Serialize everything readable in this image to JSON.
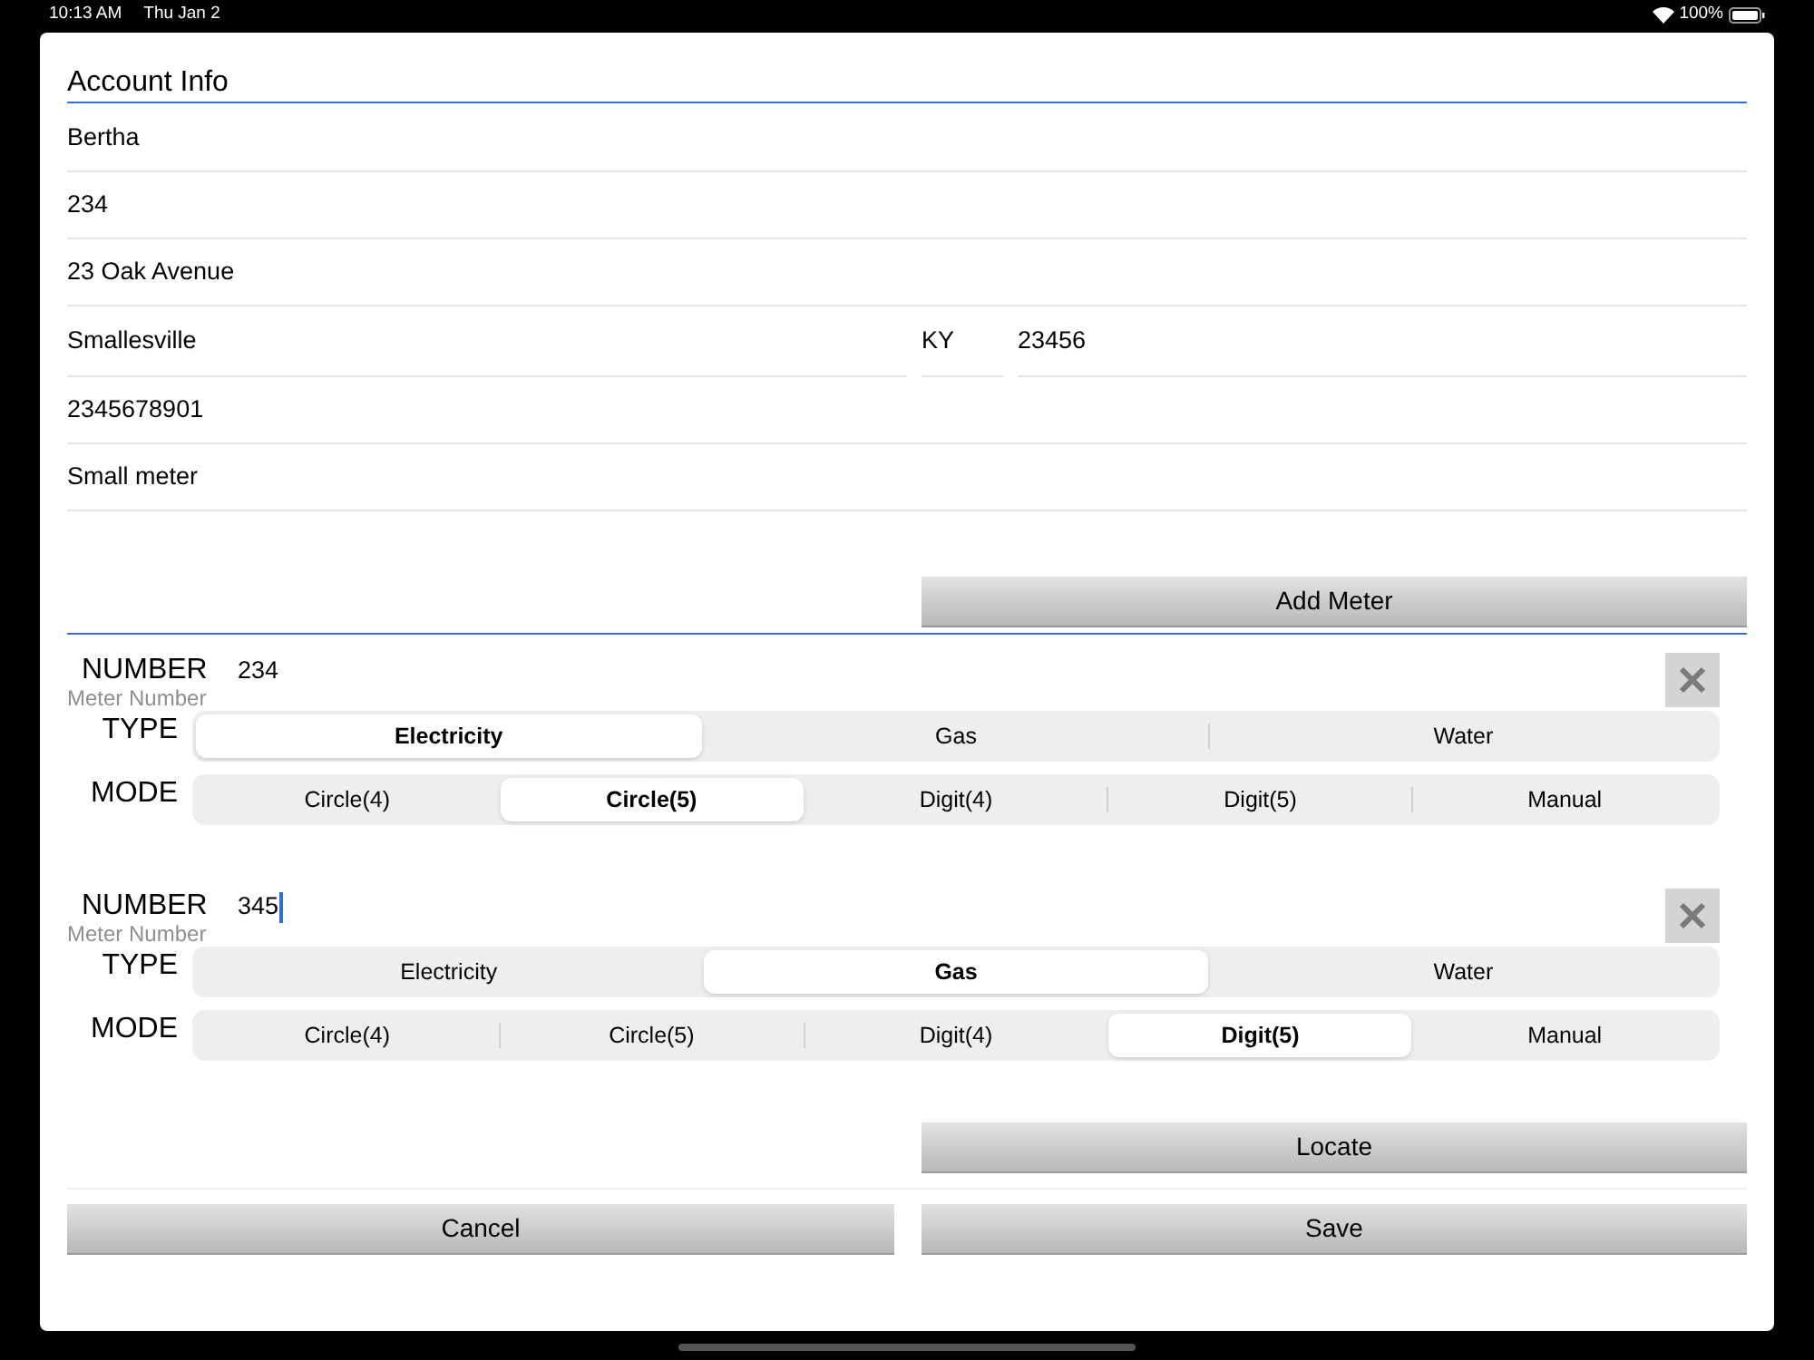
{
  "status_bar": {
    "time": "10:13 AM",
    "date": "Thu Jan 2",
    "battery": "100%"
  },
  "account": {
    "title": "Account Info",
    "fields": [
      {
        "value": "Bertha"
      },
      {
        "value": "234"
      },
      {
        "value": "23 Oak Avenue"
      }
    ],
    "city": {
      "value": "Smallesville"
    },
    "state": {
      "value": "KY"
    },
    "zip": {
      "value": "23456"
    },
    "fields_after": [
      {
        "value": "2345678901"
      },
      {
        "value": "Small meter"
      }
    ],
    "add_button": "Add Meter"
  },
  "meters": [
    {
      "number_label": "NUMBER",
      "number": "234",
      "focused": false,
      "hint": "Meter Number",
      "type_label": "TYPE",
      "types": [
        {
          "label": "Electricity",
          "selected": true
        },
        {
          "label": "Gas",
          "selected": false
        },
        {
          "label": "Water",
          "selected": false
        }
      ],
      "mode_label": "MODE",
      "modes": [
        {
          "label": "Circle(4)",
          "selected": false
        },
        {
          "label": "Circle(5)",
          "selected": true
        },
        {
          "label": "Digit(4)",
          "selected": false
        },
        {
          "label": "Digit(5)",
          "selected": false
        },
        {
          "label": "Manual",
          "selected": false
        }
      ]
    },
    {
      "number_label": "NUMBER",
      "number": "345",
      "focused": true,
      "hint": "Meter Number",
      "type_label": "TYPE",
      "types": [
        {
          "label": "Electricity",
          "selected": false
        },
        {
          "label": "Gas",
          "selected": true
        },
        {
          "label": "Water",
          "selected": false
        }
      ],
      "mode_label": "MODE",
      "modes": [
        {
          "label": "Circle(4)",
          "selected": false
        },
        {
          "label": "Circle(5)",
          "selected": false
        },
        {
          "label": "Digit(4)",
          "selected": false
        },
        {
          "label": "Digit(5)",
          "selected": true
        },
        {
          "label": "Manual",
          "selected": false
        }
      ]
    }
  ],
  "locate_button": "Locate",
  "cancel_button": "Cancel",
  "save_button": "Save"
}
